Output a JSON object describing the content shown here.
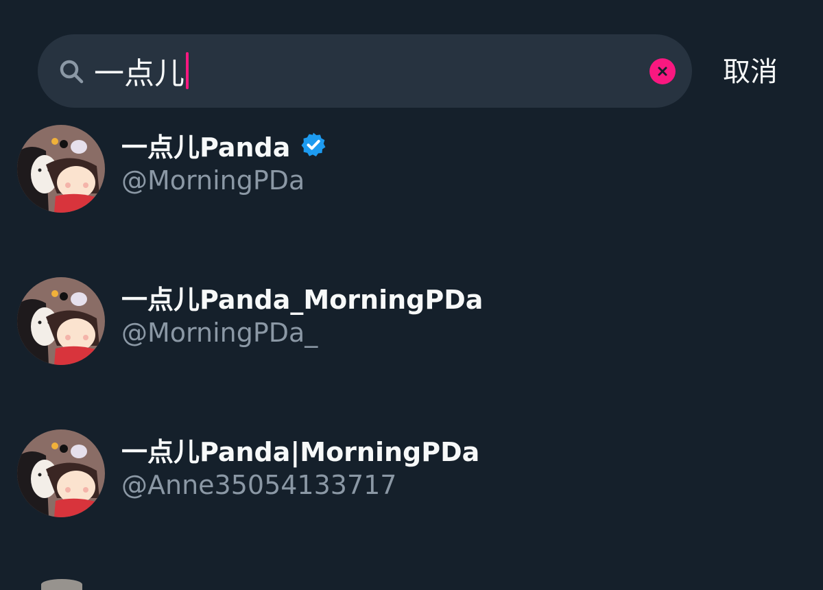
{
  "search": {
    "query": "一点儿",
    "cancel_label": "取消"
  },
  "results": [
    {
      "display_name": "一点儿Panda",
      "handle": "@MorningPDa",
      "verified": true
    },
    {
      "display_name": "一点儿Panda_MorningPDa",
      "handle": "@MorningPDa_",
      "verified": false
    },
    {
      "display_name": "一点儿Panda|MorningPDa",
      "handle": "@Anne35054133717",
      "verified": false
    }
  ],
  "colors": {
    "background": "#15202b",
    "search_field": "#273340",
    "accent_pink": "#f91880",
    "verified_blue": "#1d9bf0",
    "primary_text": "#f7f9f9",
    "secondary_text": "#8b98a5"
  }
}
